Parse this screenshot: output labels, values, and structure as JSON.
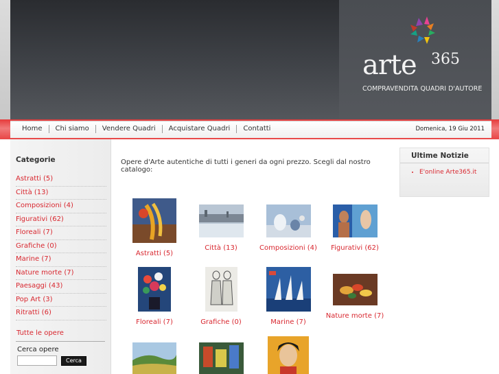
{
  "header": {
    "logo_name": "arte",
    "logo_sup": "365",
    "logo_tagline": "COMPRAVENDITA QUADRI D'AUTORE"
  },
  "nav": {
    "items": [
      "Home",
      "Chi siamo",
      "Vendere Quadri",
      "Acquistare Quadri",
      "Contatti"
    ],
    "date": "Domenica, 19 Giu 2011"
  },
  "sidebar": {
    "title": "Categorie",
    "categories": [
      "Astratti (5)",
      "Città (13)",
      "Composizioni (4)",
      "Figurativi (62)",
      "Floreali (7)",
      "Grafiche (0)",
      "Marine (7)",
      "Nature morte (7)",
      "Paesaggi (43)",
      "Pop Art (3)",
      "Ritratti (6)"
    ],
    "all_works": "Tutte le opere",
    "search_label": "Cerca opere",
    "search_value": "",
    "search_button": "Cerca"
  },
  "main": {
    "intro": "Opere d'Arte autentiche di tutti i generi da ogni prezzo. Scegli dal nostro catalogo:",
    "artworks": [
      {
        "caption": "Astratti (5)"
      },
      {
        "caption": "Città (13)"
      },
      {
        "caption": "Composizioni (4)"
      },
      {
        "caption": "Figurativi (62)"
      },
      {
        "caption": "Floreali (7)"
      },
      {
        "caption": "Grafiche (0)"
      },
      {
        "caption": "Marine (7)"
      },
      {
        "caption": "Nature morte (7)"
      },
      {
        "caption": ""
      },
      {
        "caption": ""
      },
      {
        "caption": ""
      }
    ]
  },
  "news": {
    "title": "Ultime Notizie",
    "items": [
      "E'online Arte365.it"
    ]
  }
}
